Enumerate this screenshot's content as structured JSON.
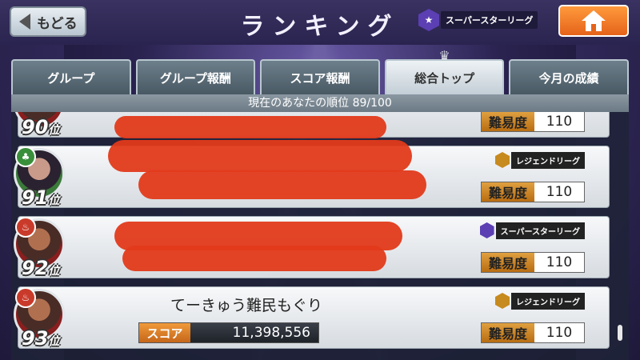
{
  "header": {
    "back_label": "もどる",
    "title": "ランキング",
    "league_label": "スーパースターリーグ",
    "home_icon": "home-icon"
  },
  "tabs": [
    {
      "label": "グループ",
      "active": false
    },
    {
      "label": "グループ報酬",
      "active": false
    },
    {
      "label": "スコア報酬",
      "active": false
    },
    {
      "label": "総合トップ",
      "active": true
    },
    {
      "label": "今月の成績",
      "active": false
    }
  ],
  "rank_info": "現在のあなたの順位 89/100",
  "rows": [
    {
      "rank": "90",
      "rank_suffix": "位",
      "difficulty_label": "難易度",
      "difficulty": "110",
      "league": ""
    },
    {
      "rank": "91",
      "rank_suffix": "位",
      "difficulty_label": "難易度",
      "difficulty": "110",
      "league": "レジェンドリーグ"
    },
    {
      "rank": "92",
      "rank_suffix": "位",
      "difficulty_label": "難易度",
      "difficulty": "110",
      "league": "スーパースターリーグ"
    },
    {
      "rank": "93",
      "rank_suffix": "位",
      "difficulty_label": "難易度",
      "difficulty": "110",
      "league": "レジェンドリーグ",
      "name": "てーきゅう難民もぐり",
      "score_label": "スコア",
      "score": "11,398,556"
    }
  ],
  "colors": {
    "accent_orange": "#e5631a",
    "redaction": "#e23a1a"
  }
}
